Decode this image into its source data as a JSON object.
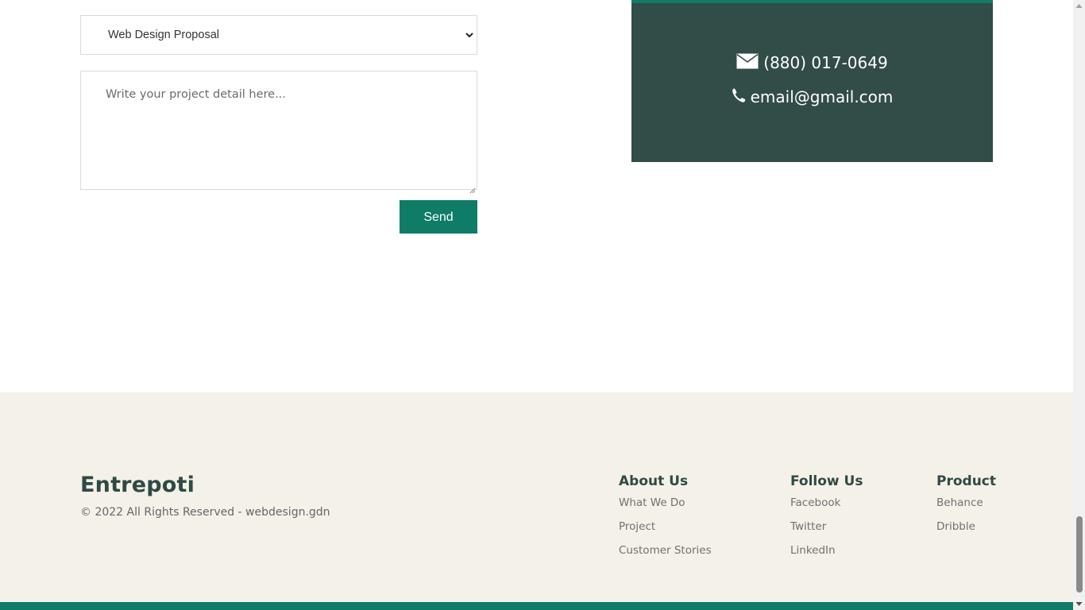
{
  "form": {
    "subject_select": {
      "selected": "Web Design Proposal"
    },
    "project_detail": {
      "placeholder": "Write your project detail here..."
    },
    "send_label": "Send"
  },
  "contact": {
    "phone": "(880) 017-0649",
    "phone_icon": "envelope-icon",
    "email": "email@gmail.com",
    "email_icon": "phone-icon",
    "card_color": "#324c48",
    "accent_color": "#0e7c66"
  },
  "footer": {
    "brand": "Entrepoti",
    "copyright": "© 2022 All Rights Reserved - webdesign.gdn",
    "columns": [
      {
        "title": "About Us",
        "links": [
          "What We Do",
          "Project",
          "Customer Stories"
        ]
      },
      {
        "title": "Follow Us",
        "links": [
          "Facebook",
          "Twitter",
          "LinkedIn"
        ]
      },
      {
        "title": "Product",
        "links": [
          "Behance",
          "Dribble"
        ]
      }
    ],
    "background": "#f4f1e9"
  }
}
